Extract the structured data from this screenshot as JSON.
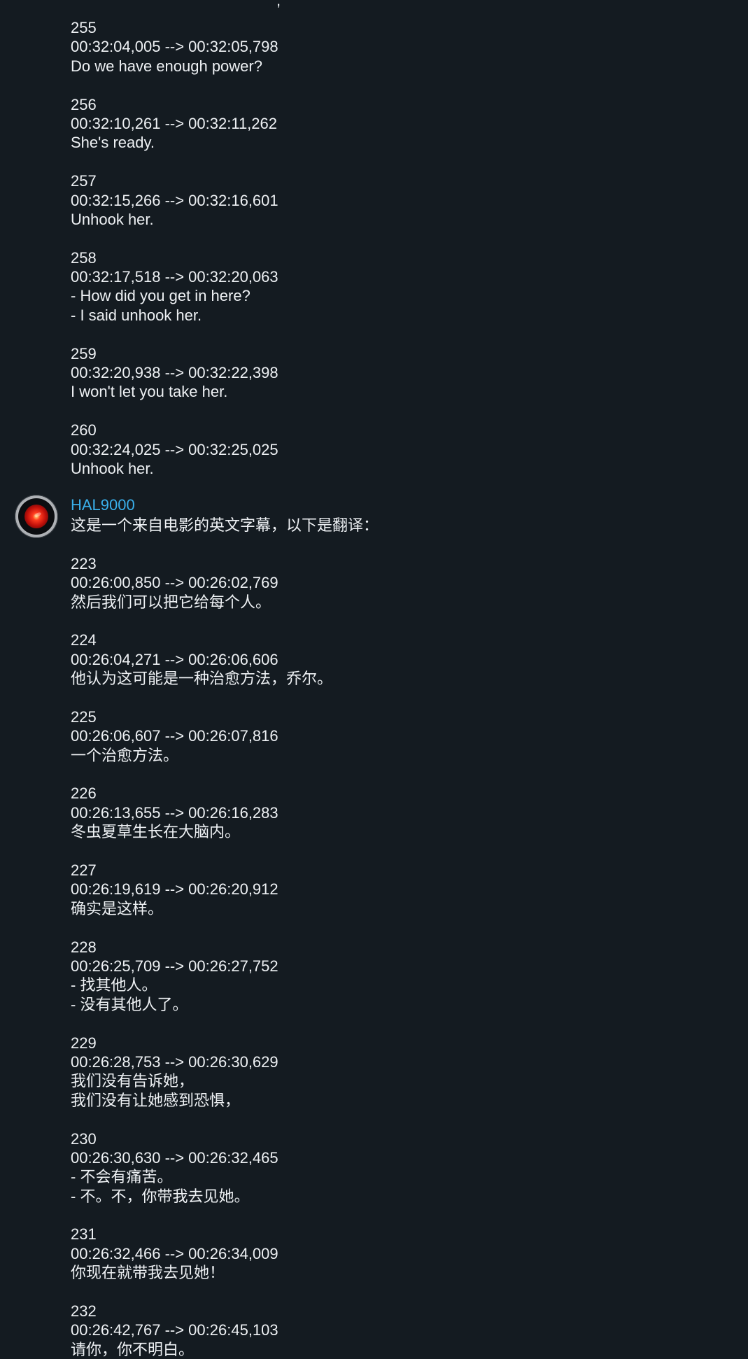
{
  "previous_message": {
    "top_fragment": ",",
    "subtitles": [
      {
        "index": "255",
        "time": "00:32:04,005 --> 00:32:05,798",
        "lines": [
          "Do we have enough power?"
        ]
      },
      {
        "index": "256",
        "time": "00:32:10,261 --> 00:32:11,262",
        "lines": [
          "She's ready."
        ]
      },
      {
        "index": "257",
        "time": "00:32:15,266 --> 00:32:16,601",
        "lines": [
          "Unhook her."
        ]
      },
      {
        "index": "258",
        "time": "00:32:17,518 --> 00:32:20,063",
        "lines": [
          "- How did you get in here?",
          "- I said unhook her."
        ]
      },
      {
        "index": "259",
        "time": "00:32:20,938 --> 00:32:22,398",
        "lines": [
          "I won't let you take her."
        ]
      },
      {
        "index": "260",
        "time": "00:32:24,025 --> 00:32:25,025",
        "lines": [
          "Unhook her."
        ]
      }
    ]
  },
  "hal_message": {
    "sender": "HAL9000",
    "avatar_icon": "hal9000-eye-icon",
    "intro": "这是一个来自电影的英文字幕，以下是翻译：",
    "subtitles": [
      {
        "index": "223",
        "time": "00:26:00,850 --> 00:26:02,769",
        "lines": [
          "然后我们可以把它给每个人。"
        ]
      },
      {
        "index": "224",
        "time": "00:26:04,271 --> 00:26:06,606",
        "lines": [
          "他认为这可能是一种治愈方法，乔尔。"
        ]
      },
      {
        "index": "225",
        "time": "00:26:06,607 --> 00:26:07,816",
        "lines": [
          "一个治愈方法。"
        ]
      },
      {
        "index": "226",
        "time": "00:26:13,655 --> 00:26:16,283",
        "lines": [
          "冬虫夏草生长在大脑内。"
        ]
      },
      {
        "index": "227",
        "time": "00:26:19,619 --> 00:26:20,912",
        "lines": [
          "确实是这样。"
        ]
      },
      {
        "index": "228",
        "time": "00:26:25,709 --> 00:26:27,752",
        "lines": [
          "- 找其他人。",
          "- 没有其他人了。"
        ]
      },
      {
        "index": "229",
        "time": "00:26:28,753 --> 00:26:30,629",
        "lines": [
          "我们没有告诉她，",
          "我们没有让她感到恐惧，"
        ]
      },
      {
        "index": "230",
        "time": "00:26:30,630 --> 00:26:32,465",
        "lines": [
          "- 不会有痛苦。",
          "- 不。不，你带我去见她。"
        ]
      },
      {
        "index": "231",
        "time": "00:26:32,466 --> 00:26:34,009",
        "lines": [
          "你现在就带我去见她！"
        ]
      },
      {
        "index": "232",
        "time": "00:26:42,767 --> 00:26:45,103",
        "lines": [
          "请你，你不明白。"
        ]
      }
    ]
  },
  "colors": {
    "background": "#141b21",
    "text": "#eef1f4",
    "sender_name": "#3ab0ec",
    "avatar_eye": "#d41a10"
  }
}
